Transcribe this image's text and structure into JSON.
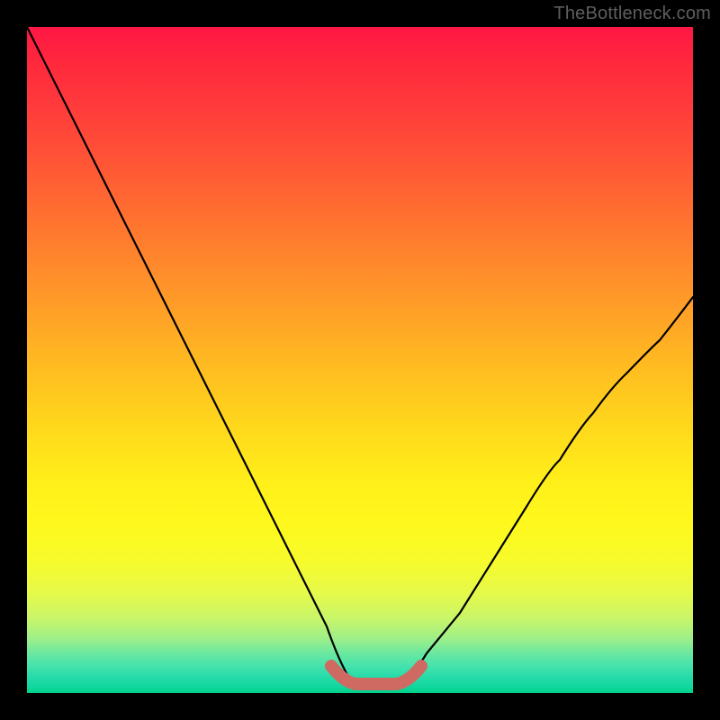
{
  "watermark": "TheBottleneck.com",
  "chart_data": {
    "type": "line",
    "title": "",
    "xlabel": "",
    "ylabel": "",
    "xlim": [
      0,
      1
    ],
    "ylim": [
      0,
      1
    ],
    "series": [
      {
        "name": "bottleneck-curve",
        "x": [
          0.0,
          0.05,
          0.1,
          0.15,
          0.2,
          0.25,
          0.3,
          0.35,
          0.4,
          0.45,
          0.48,
          0.5,
          0.55,
          0.58,
          0.6,
          0.65,
          0.7,
          0.75,
          0.8,
          0.85,
          0.9,
          0.95,
          1.0
        ],
        "values": [
          1.0,
          0.9,
          0.8,
          0.7,
          0.6,
          0.5,
          0.4,
          0.3,
          0.2,
          0.1,
          0.03,
          0.01,
          0.01,
          0.03,
          0.06,
          0.12,
          0.2,
          0.28,
          0.35,
          0.42,
          0.48,
          0.54,
          0.6
        ]
      }
    ],
    "annotations": [
      {
        "name": "trough-highlight",
        "x_start": 0.46,
        "x_end": 0.6,
        "y": 0.02
      }
    ]
  }
}
